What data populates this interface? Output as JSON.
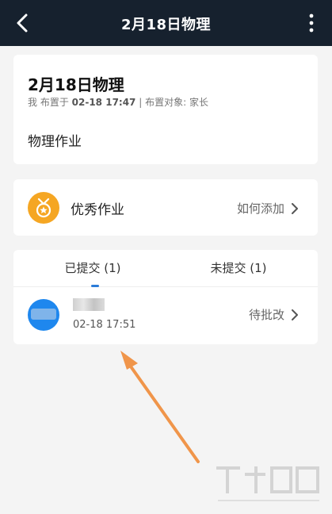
{
  "topbar": {
    "title": "2月18日物理",
    "back_icon": "back-arrow-icon",
    "more_icon": "more-vertical-icon"
  },
  "homework": {
    "title": "2月18日物理",
    "meta_prefix": "我 布置于",
    "assigned_time": "02-18 17:47",
    "meta_suffix": "| 布置对象: 家长",
    "content": "物理作业"
  },
  "excellent": {
    "label": "优秀作业",
    "action": "如何添加",
    "icon": "medal-icon"
  },
  "tabs": [
    {
      "label": "已提交 (1)",
      "active": true
    },
    {
      "label": "未提交 (1)",
      "active": false
    }
  ],
  "submissions": [
    {
      "time": "02-18 17:51",
      "status": "待批改"
    }
  ],
  "colors": {
    "topbar": "#16212e",
    "accent": "#2b7bd8",
    "medal": "#f5a623",
    "arrow": "#f0954a"
  }
}
